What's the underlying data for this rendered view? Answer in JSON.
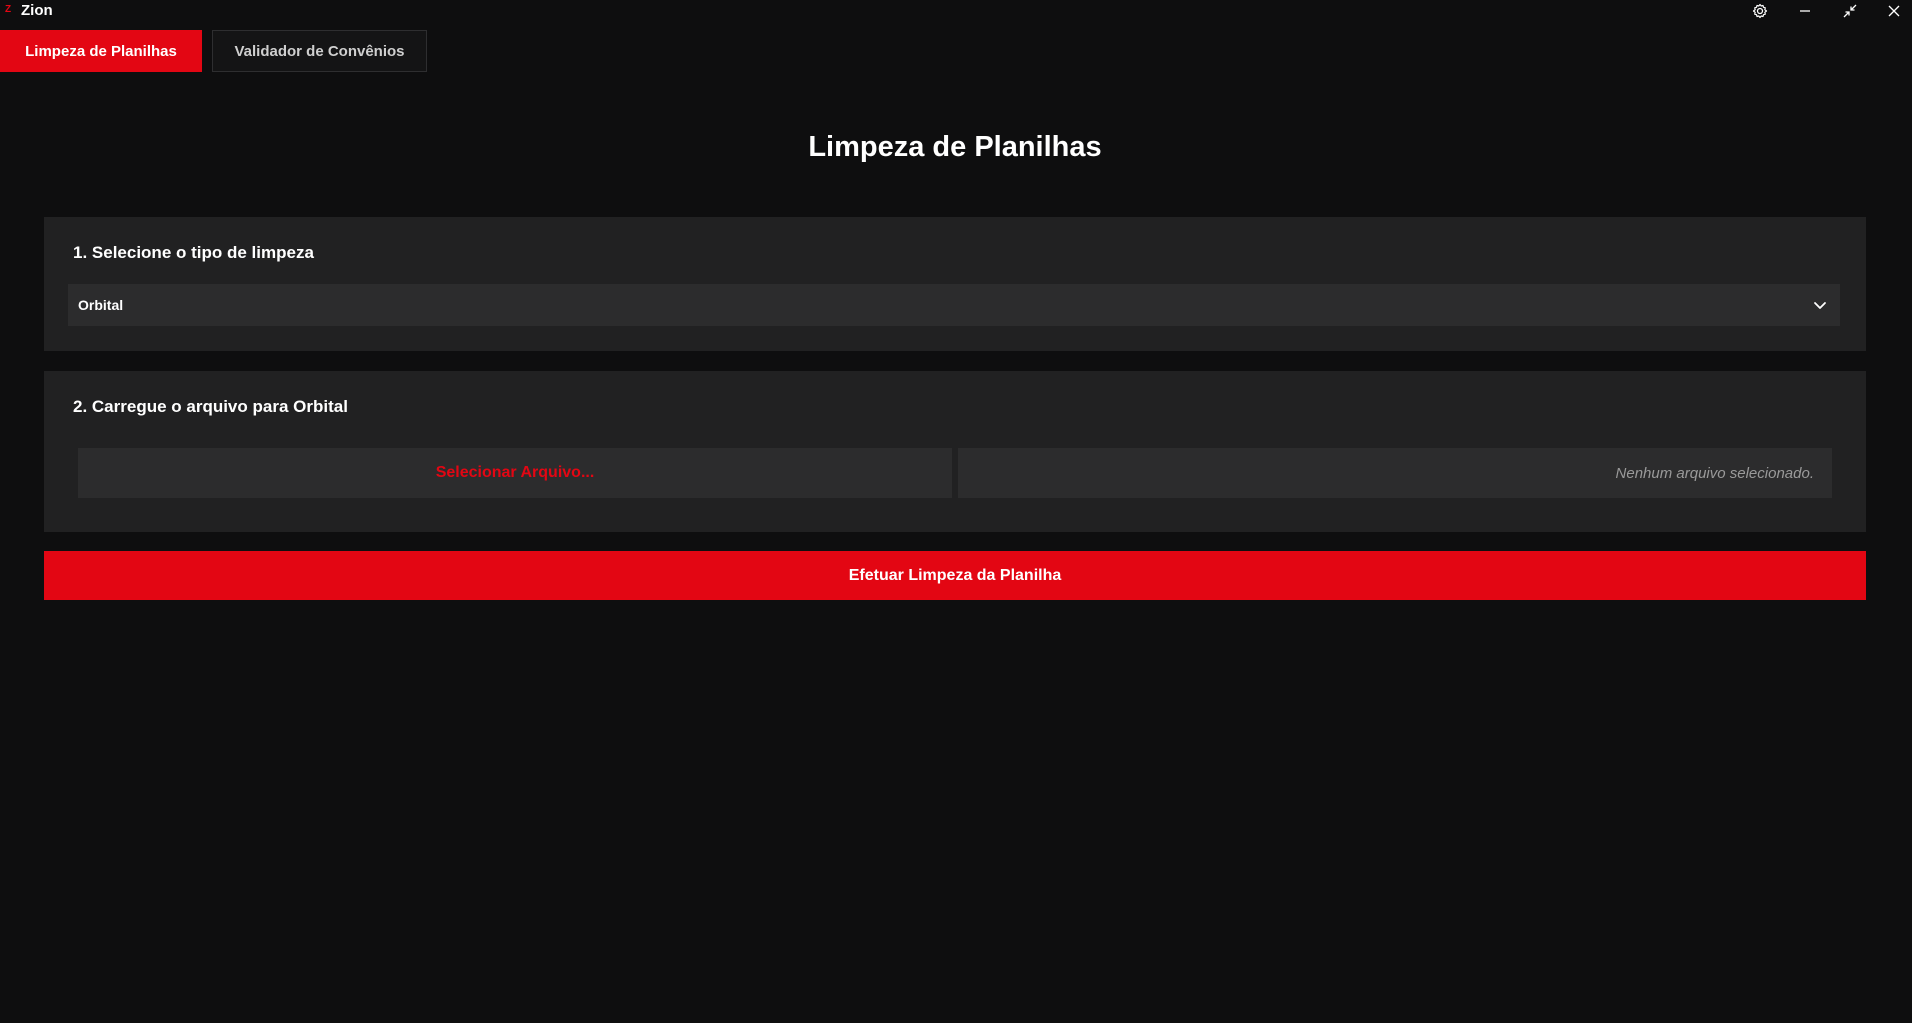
{
  "app": {
    "title": "Zion",
    "logo_letter": "Z",
    "accent": "#e30613"
  },
  "window_controls": {
    "settings_icon": "gear-icon",
    "minimize_icon": "minimize-icon",
    "restore_icon": "restore-icon",
    "close_icon": "close-icon"
  },
  "tabs": [
    {
      "label": "Limpeza de Planilhas",
      "active": true
    },
    {
      "label": "Validador de Convênios",
      "active": false
    }
  ],
  "main": {
    "title": "Limpeza de Planilhas",
    "step1": {
      "heading": "1. Selecione o tipo de limpeza",
      "selected_value": "Orbital"
    },
    "step2": {
      "heading": "2. Carregue o arquivo para Orbital",
      "select_file_label": "Selecionar Arquivo...",
      "file_status": "Nenhum arquivo selecionado."
    },
    "run_button_label": "Efetuar Limpeza da Planilha"
  }
}
